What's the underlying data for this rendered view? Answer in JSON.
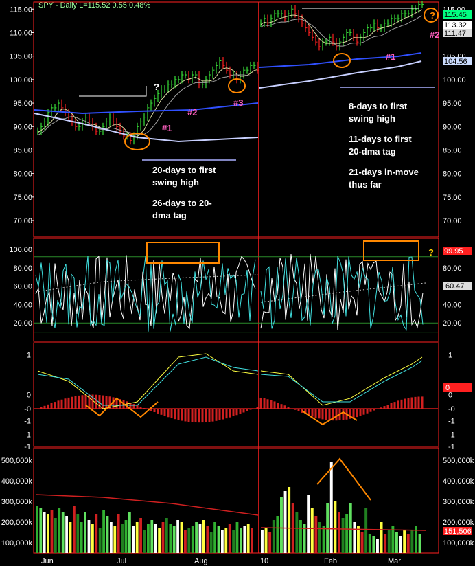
{
  "header": {
    "text": "SPY - Daily  L=115.52  0.55   0.48%"
  },
  "colors": {
    "background": "#000000",
    "frame": "#ff2020",
    "up": "#38e038",
    "down": "#ff2020",
    "ma50": "#3050ff",
    "ma200": "#c8d0ff",
    "annotation": "#ff8800",
    "pink": "#ff60c0"
  },
  "chart_data": [
    {
      "type": "line",
      "panel": "price",
      "ylim": [
        66.5,
        116.5
      ],
      "yticks": [
        "115.00",
        "110.00",
        "105.00",
        "100.00",
        "95.00",
        "90.00",
        "85.00",
        "80.00",
        "75.00",
        "70.00"
      ],
      "price_labels": [
        "115.45",
        "113.32",
        "111.47",
        "104.56"
      ],
      "series": [
        {
          "segment": "left",
          "x": [
            0,
            5,
            10,
            15,
            20,
            25,
            30,
            35,
            40,
            45,
            50,
            55,
            60,
            65,
            70,
            75,
            80,
            85,
            90,
            95,
            100,
            105,
            110,
            115,
            120,
            125,
            130,
            135,
            140,
            145,
            150,
            155,
            160,
            165,
            170,
            175,
            180,
            185,
            190,
            195,
            200,
            205,
            210,
            215,
            220,
            225,
            230,
            235,
            240,
            245,
            250,
            255,
            260,
            265,
            270,
            275,
            280,
            285,
            290,
            295,
            300,
            305,
            310,
            315,
            320
          ],
          "values": [
            89,
            90,
            91,
            93,
            94,
            94,
            95,
            94,
            93,
            92,
            91,
            90,
            90,
            91,
            92,
            91,
            90,
            89,
            89,
            90,
            91,
            92,
            91,
            90,
            89,
            88,
            88,
            87,
            88,
            90,
            91,
            92,
            94,
            95,
            96,
            97,
            98,
            98,
            99,
            99,
            100,
            100,
            101,
            101,
            100,
            101,
            101,
            99,
            99,
            100,
            101,
            102,
            103,
            104,
            103,
            102,
            101,
            101,
            100,
            101,
            102,
            102,
            103,
            103,
            102
          ]
        },
        {
          "segment": "right",
          "x": [
            0,
            5,
            10,
            15,
            20,
            25,
            30,
            35,
            40,
            45,
            50,
            55,
            60,
            65,
            70,
            75,
            80,
            85,
            90,
            95,
            100,
            105,
            110,
            115,
            120,
            125,
            130,
            135,
            140,
            145,
            150,
            155,
            160,
            165,
            170,
            175,
            180,
            185,
            190,
            195,
            200,
            205,
            210,
            215,
            220,
            225,
            230,
            235
          ],
          "values": [
            112,
            113,
            112,
            113,
            114,
            114,
            114,
            113,
            114,
            115,
            114,
            113,
            112,
            111,
            110,
            109,
            108,
            107,
            108,
            108,
            109,
            108,
            107,
            108,
            109,
            110,
            110,
            109,
            108,
            109,
            110,
            111,
            111,
            112,
            111,
            111,
            112,
            112,
            113,
            113,
            113,
            114,
            114,
            114,
            115,
            115,
            116,
            116
          ]
        }
      ]
    },
    {
      "type": "line",
      "panel": "stochastics",
      "ylim": [
        0,
        112
      ],
      "yticks": [
        "100.00",
        "80.00",
        "60.00",
        "40.00",
        "20.00"
      ],
      "labels": [
        "99.95",
        "60.47",
        "?"
      ]
    },
    {
      "type": "line",
      "panel": "macd",
      "ylim": [
        -1.3,
        1.3
      ],
      "yticks": [
        "1",
        "0",
        "-0",
        "-1",
        "-1",
        "-1"
      ],
      "labels": [
        "0"
      ]
    },
    {
      "type": "bar",
      "panel": "volume",
      "ylim": [
        50000,
        560000
      ],
      "yticks": [
        "500,000k",
        "400,000k",
        "300,000k",
        "200,000k",
        "100,000k"
      ],
      "last_label": "151,506",
      "values_left": [
        280000,
        270000,
        250000,
        240000,
        260000,
        220000,
        270000,
        250000,
        230000,
        200000,
        280000,
        240000,
        200000,
        250000,
        210000,
        190000,
        240000,
        170000,
        260000,
        230000,
        200000,
        180000,
        240000,
        190000,
        210000,
        250000,
        180000,
        200000,
        220000,
        160000,
        190000,
        210000,
        190000,
        170000,
        200000,
        220000,
        190000,
        180000,
        210000,
        200000,
        160000,
        170000,
        180000,
        200000,
        190000,
        210000,
        180000,
        150000,
        200000,
        180000,
        160000,
        170000,
        190000,
        160000,
        200000,
        170000,
        180000,
        190000,
        170000
      ],
      "values_right": [
        160000,
        170000,
        150000,
        210000,
        230000,
        320000,
        350000,
        370000,
        290000,
        250000,
        210000,
        190000,
        330000,
        270000,
        230000,
        200000,
        180000,
        290000,
        490000,
        300000,
        250000,
        220000,
        240000,
        290000,
        200000,
        180000,
        150000,
        270000,
        140000,
        130000,
        120000,
        200000,
        140000,
        160000,
        180000,
        150000,
        130000,
        160000,
        140000,
        160000,
        180000,
        140000
      ]
    }
  ],
  "annotations": {
    "left_question": "?",
    "right_question": "?",
    "markers": [
      "#1",
      "#2",
      "#3",
      "#1",
      "#2"
    ],
    "left_text_1": [
      "20-days to first",
      "swing high"
    ],
    "left_text_2": [
      "26-days to 20-",
      "dma tag"
    ],
    "right_text_1": [
      "8-days to first",
      "swing high"
    ],
    "right_text_2": [
      "11-days to first",
      "20-dma tag"
    ],
    "right_text_3": [
      "21-days in-move",
      "thus far"
    ]
  },
  "x_axis": {
    "labels": [
      "Jun",
      "Jul",
      "Aug",
      "10",
      "Feb",
      "Mar"
    ]
  }
}
